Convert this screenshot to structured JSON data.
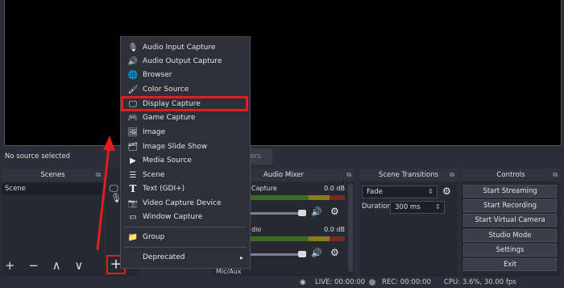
{
  "preview": {},
  "source_bar": {
    "text": "No source selected",
    "filters_tab": "lters"
  },
  "docks": {
    "scenes": {
      "title": "Scenes",
      "items": [
        "Scene"
      ],
      "tools": "+ − ∧ ∨"
    },
    "mixer": {
      "title": "Audio Mixer",
      "channels": [
        {
          "name": "Capture",
          "db": "0.0 dB"
        },
        {
          "name": "dio",
          "db": "0.0 dB"
        }
      ],
      "mic_label": "Mic/Aux"
    },
    "transitions": {
      "title": "Scene Transitions",
      "selected": "Fade",
      "duration_label": "Duration",
      "duration_value": "300 ms"
    },
    "controls": {
      "title": "Controls",
      "buttons": [
        "Start Streaming",
        "Start Recording",
        "Start Virtual Camera",
        "Studio Mode",
        "Settings",
        "Exit"
      ]
    }
  },
  "add_button": "+",
  "menu": {
    "items": [
      {
        "icon": "microphone-icon",
        "glyph": "🎙",
        "label": "Audio Input Capture"
      },
      {
        "icon": "speaker-icon",
        "glyph": "🔊",
        "label": "Audio Output Capture"
      },
      {
        "icon": "globe-icon",
        "glyph": "🌐",
        "label": "Browser"
      },
      {
        "icon": "brush-icon",
        "glyph": "🖌",
        "label": "Color Source"
      },
      {
        "icon": "monitor-icon",
        "glyph": "🖵",
        "label": "Display Capture"
      },
      {
        "icon": "gamepad-icon",
        "glyph": "🎮",
        "label": "Game Capture"
      },
      {
        "icon": "image-icon",
        "glyph": "🖼",
        "label": "Image"
      },
      {
        "icon": "slideshow-icon",
        "glyph": "🗂",
        "label": "Image Slide Show"
      },
      {
        "icon": "play-icon",
        "glyph": "▶",
        "label": "Media Source"
      },
      {
        "icon": "scene-icon",
        "glyph": "☰",
        "label": "Scene"
      },
      {
        "icon": "text-icon",
        "glyph": "T",
        "label": "Text (GDI+)"
      },
      {
        "icon": "camera-icon",
        "glyph": "📷",
        "label": "Video Capture Device"
      },
      {
        "icon": "window-icon",
        "glyph": "▭",
        "label": "Window Capture"
      }
    ],
    "group": {
      "icon": "folder-icon",
      "glyph": "📁",
      "label": "Group"
    },
    "deprecated": {
      "label": "Deprecated",
      "arrow": "▸"
    }
  },
  "status": {
    "live": "LIVE: 00:00:00",
    "rec": "REC: 00:00:00",
    "cpu": "CPU: 3.6%, 30.00 fps"
  },
  "colors": {
    "highlight": "#e21d1d",
    "panel": "#262932",
    "background": "#2b2e38"
  }
}
